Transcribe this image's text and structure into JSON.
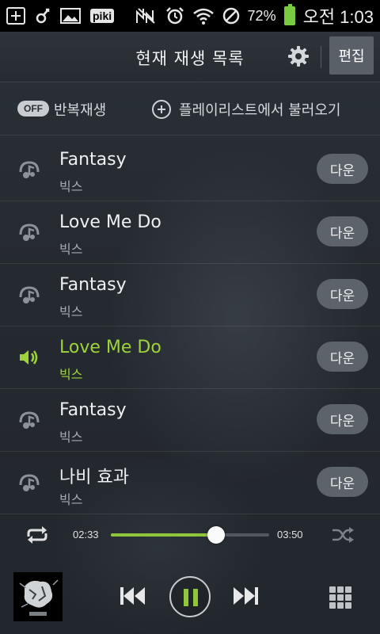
{
  "status_bar": {
    "app_badge": "piki",
    "battery_percent": "72%",
    "time": "오전 1:03"
  },
  "header": {
    "title": "현재 재생 목록",
    "edit_label": "편집"
  },
  "options": {
    "repeat_toggle": "OFF",
    "repeat_label": "반복재생",
    "load_playlist_label": "플레이리스트에서 불러오기"
  },
  "playlist": [
    {
      "title": "Fantasy",
      "artist": "빅스",
      "next_label": "다운",
      "active": false
    },
    {
      "title": "Love Me Do",
      "artist": "빅스",
      "next_label": "다운",
      "active": false
    },
    {
      "title": "Fantasy",
      "artist": "빅스",
      "next_label": "다운",
      "active": false
    },
    {
      "title": "Love Me Do",
      "artist": "빅스",
      "next_label": "다운",
      "active": true
    },
    {
      "title": "Fantasy",
      "artist": "빅스",
      "next_label": "다운",
      "active": false
    },
    {
      "title": "나비 효과",
      "artist": "빅스",
      "next_label": "다운",
      "active": false
    }
  ],
  "player": {
    "current_time": "02:33",
    "total_time": "03:50",
    "progress_fraction": 0.665
  },
  "colors": {
    "accent": "#9ed33b",
    "background": "#20252b"
  }
}
